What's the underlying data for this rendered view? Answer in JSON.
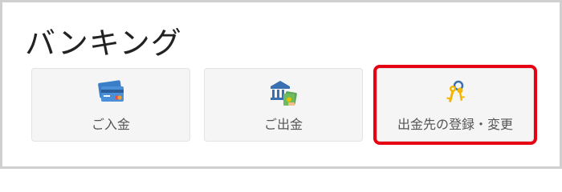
{
  "section": {
    "title": "バンキング"
  },
  "cards": [
    {
      "label": "ご入金",
      "icon": "credit-card-icon"
    },
    {
      "label": "ご出金",
      "icon": "bank-money-icon"
    },
    {
      "label": "出金先の登録・変更",
      "icon": "key-icon",
      "highlighted": true
    }
  ],
  "colors": {
    "highlight": "#e60012",
    "card_bg": "#f5f5f5",
    "text": "#555555"
  }
}
